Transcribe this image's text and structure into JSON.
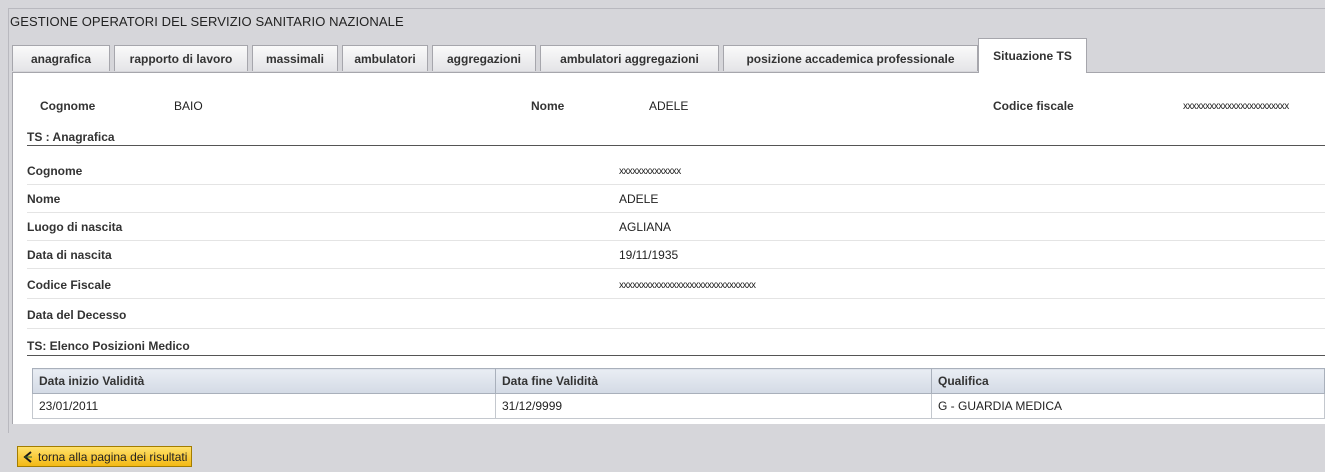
{
  "app_title": "GESTIONE OPERATORI DEL SERVIZIO SANITARIO NAZIONALE",
  "tabs": [
    {
      "label": "anagrafica"
    },
    {
      "label": "rapporto di lavoro"
    },
    {
      "label": "massimali"
    },
    {
      "label": "ambulatori"
    },
    {
      "label": "aggregazioni"
    },
    {
      "label": "ambulatori aggregazioni"
    },
    {
      "label": "posizione accademica professionale"
    },
    {
      "label": "Situazione TS",
      "active": true
    }
  ],
  "header": {
    "cognome_label": "Cognome",
    "cognome_value": "BAIO",
    "nome_label": "Nome",
    "nome_value": "ADELE",
    "cf_label": "Codice fiscale",
    "cf_value": "xxxxxxxxxxxxxxxxxxxxxxxx"
  },
  "anagrafica": {
    "title": "TS : Anagrafica",
    "rows": [
      {
        "label": "Cognome",
        "value": "xxxxxxxxxxxxxx"
      },
      {
        "label": "Nome",
        "value": "ADELE"
      },
      {
        "label": "Luogo di nascita",
        "value": "AGLIANA"
      },
      {
        "label": "Data di nascita",
        "value": "19/11/1935"
      },
      {
        "label": "Codice Fiscale",
        "value": "xxxxxxxxxxxxxxxxxxxxxxxxxxxxxxx"
      },
      {
        "label": "Data del Decesso",
        "value": ""
      }
    ]
  },
  "posizioni": {
    "title": "TS: Elenco Posizioni Medico",
    "columns": [
      "Data inizio Validità",
      "Data fine Validità",
      "Qualifica"
    ],
    "rows": [
      [
        "23/01/2011",
        "31/12/9999",
        "G - GUARDIA MEDICA"
      ]
    ]
  },
  "back_button": {
    "label": "torna alla pagina dei risultati"
  },
  "colors": {
    "button_bg": "#f3b915",
    "table_header_bg": "#d3dae5",
    "page_bg": "#d6d6da"
  }
}
